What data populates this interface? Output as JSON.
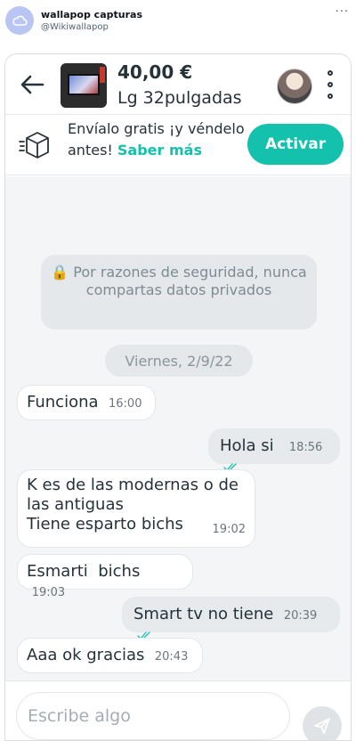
{
  "tweet": {
    "display_name": "wallapop capturas",
    "handle": "@Wikiwallapop",
    "more": "···"
  },
  "chat": {
    "header": {
      "price": "40,00 €",
      "product_title": "Lg 32pulgadas"
    },
    "banner": {
      "text": "Envíalo gratis ¡y véndelo antes!",
      "link": "Saber más",
      "activate_label": "Activar"
    },
    "security_notice": "🔒 Por razones de seguridad, nunca compartas datos privados",
    "date_divider": "Viernes, 2/9/22",
    "messages": [
      {
        "direction": "in",
        "text": "Funciona",
        "time": "16:00"
      },
      {
        "direction": "out",
        "text": "Hola si",
        "time": "18:56",
        "read": true
      },
      {
        "direction": "in",
        "text": "K es de las modernas o de las antiguas\nTiene esparto bichs",
        "time": "19:02"
      },
      {
        "direction": "in",
        "text": "Esmarti  bichs",
        "time": "19:03"
      },
      {
        "direction": "out",
        "text": "Smart tv no tiene",
        "time": "20:39",
        "read": true
      },
      {
        "direction": "in",
        "text": "Aaa ok gracias",
        "time": "20:43"
      }
    ],
    "composer": {
      "placeholder": "Escribe algo"
    },
    "colors": {
      "accent": "#13c1ac",
      "incoming_bubble": "#ffffff",
      "outgoing_bubble": "#e6eaed",
      "chat_background": "#f3f5f6"
    }
  }
}
